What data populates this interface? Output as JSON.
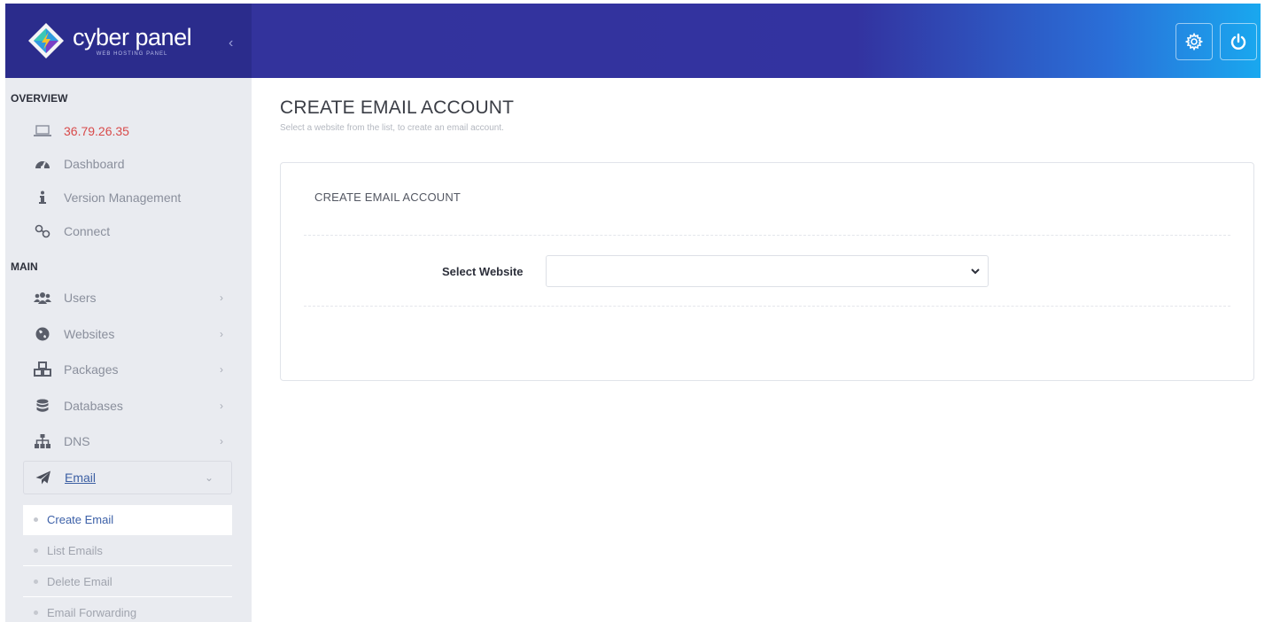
{
  "brand": {
    "name": "cyber panel",
    "tagline": "WEB HOSTING PANEL",
    "collapse_glyph": "‹"
  },
  "header": {
    "settings_icon": "gear-icon",
    "power_icon": "power-icon"
  },
  "sidebar": {
    "overview_heading": "OVERVIEW",
    "main_heading": "MAIN",
    "overview_items": [
      {
        "label": "36.79.26.35",
        "icon": "laptop-icon"
      },
      {
        "label": "Dashboard",
        "icon": "tachometer-icon"
      },
      {
        "label": "Version Management",
        "icon": "info-icon"
      },
      {
        "label": "Connect",
        "icon": "link-icon"
      }
    ],
    "main_items": [
      {
        "label": "Users",
        "icon": "users-icon",
        "chevron": "›"
      },
      {
        "label": "Websites",
        "icon": "globe-icon",
        "chevron": "›"
      },
      {
        "label": "Packages",
        "icon": "cubes-icon",
        "chevron": "›"
      },
      {
        "label": "Databases",
        "icon": "database-icon",
        "chevron": "›"
      },
      {
        "label": "DNS",
        "icon": "sitemap-icon",
        "chevron": "›"
      }
    ],
    "email": {
      "label": "Email",
      "icon": "paper-plane-icon",
      "chevron": "⌄"
    },
    "email_subitems": [
      {
        "label": "Create Email",
        "active": true
      },
      {
        "label": "List Emails",
        "active": false
      },
      {
        "label": "Delete Email",
        "active": false
      },
      {
        "label": "Email Forwarding",
        "active": false
      }
    ]
  },
  "main": {
    "title": "CREATE EMAIL ACCOUNT",
    "subtitle": "Select a website from the list, to create an email account.",
    "panel": {
      "title": "CREATE EMAIL ACCOUNT",
      "field_label": "Select Website",
      "select_value": ""
    }
  },
  "colors": {
    "brand_bg": "#2b2c8c",
    "accent_red": "#d84a4a",
    "active_link": "#3d61a8"
  }
}
